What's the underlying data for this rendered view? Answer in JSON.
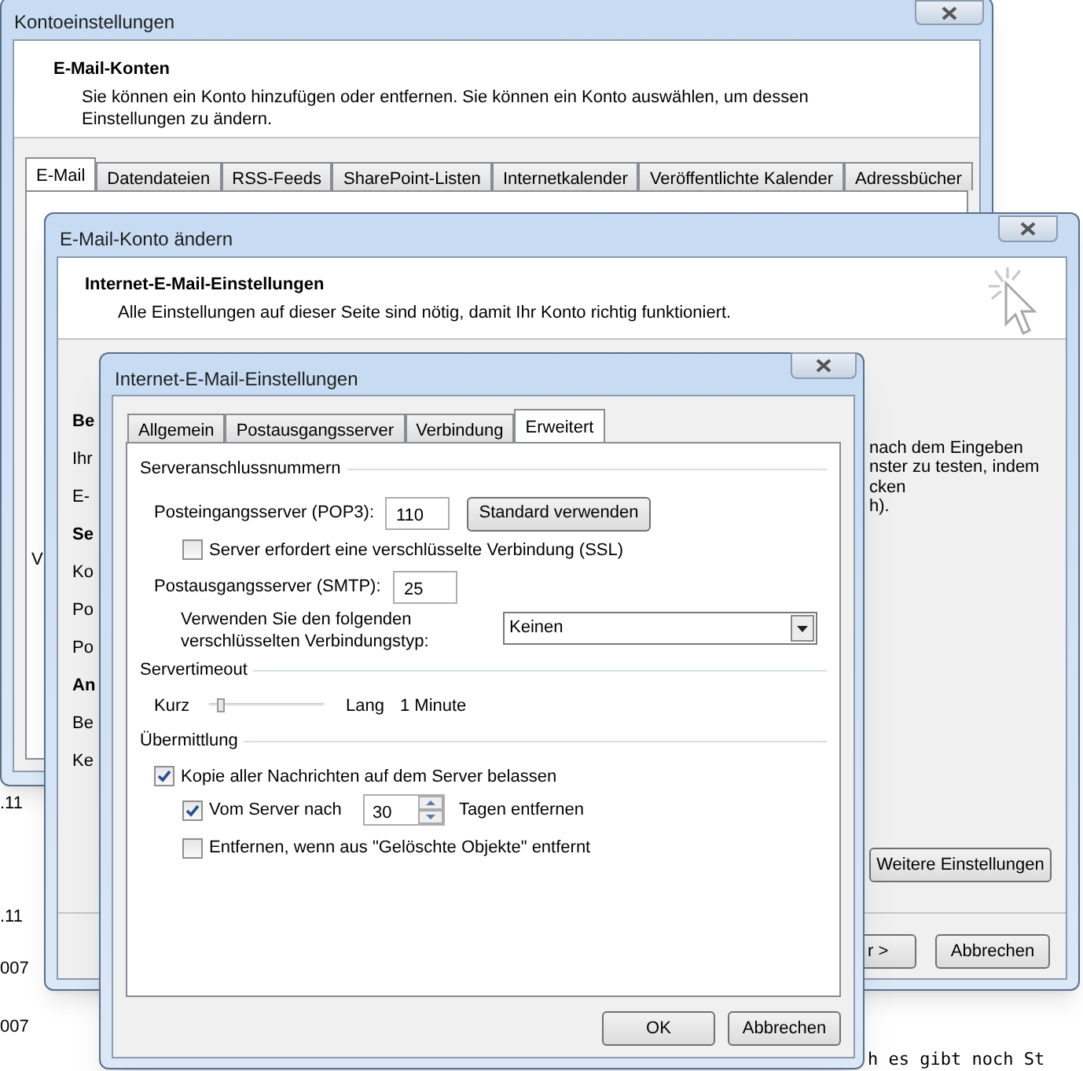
{
  "background_texts": [
    ".11",
    ".11",
    "007",
    "007",
    "h es gibt noch St"
  ],
  "account_settings": {
    "title": "Kontoeinstellungen",
    "header_title": "E-Mail-Konten",
    "header_text": "Sie können ein Konto hinzufügen oder entfernen. Sie können ein Konto auswählen, um dessen Einstellungen zu ändern.",
    "tabs": [
      {
        "label": "E-Mail",
        "selected": true
      },
      {
        "label": "Datendateien",
        "selected": false
      },
      {
        "label": "RSS-Feeds",
        "selected": false
      },
      {
        "label": "SharePoint-Listen",
        "selected": false
      },
      {
        "label": "Internetkalender",
        "selected": false
      },
      {
        "label": "Veröffentlichte Kalender",
        "selected": false
      },
      {
        "label": "Adressbücher",
        "selected": false
      }
    ],
    "partial_label": "V"
  },
  "change_account": {
    "title": "E-Mail-Konto ändern",
    "header_title": "Internet-E-Mail-Einstellungen",
    "header_text": "Alle Einstellungen auf dieser Seite sind nötig, damit Ihr Konto richtig funktioniert.",
    "left_labels": [
      {
        "text": "Be",
        "bold": true
      },
      {
        "text": "Ihr",
        "bold": false
      },
      {
        "text": "E-",
        "bold": false
      },
      {
        "text": "Se",
        "bold": true
      },
      {
        "text": "Ko",
        "bold": false
      },
      {
        "text": "Po",
        "bold": false
      },
      {
        "text": "Po",
        "bold": false
      },
      {
        "text": "An",
        "bold": true
      },
      {
        "text": "Be",
        "bold": false
      },
      {
        "text": "Ke",
        "bold": false
      }
    ],
    "right_text_lines": [
      "nach dem Eingeben",
      "nster zu testen, indem",
      "cken",
      "h)."
    ],
    "more_settings_button": "Weitere Einstellungen",
    "next_button": "r >",
    "cancel_button": "Abbrechen"
  },
  "internet_settings": {
    "title": "Internet-E-Mail-Einstellungen",
    "tabs": [
      {
        "label": "Allgemein",
        "selected": false
      },
      {
        "label": "Postausgangsserver",
        "selected": false
      },
      {
        "label": "Verbindung",
        "selected": false
      },
      {
        "label": "Erweitert",
        "selected": true
      }
    ],
    "ports_group": "Serveranschlussnummern",
    "incoming_label": "Posteingangsserver (POP3):",
    "incoming_value": "110",
    "default_button": "Standard verwenden",
    "ssl": {
      "label": "Server erfordert eine verschlüsselte Verbindung (SSL)",
      "checked": false
    },
    "outgoing_label": "Postausgangsserver (SMTP):",
    "outgoing_value": "25",
    "encryption_label": "Verwenden Sie den folgenden verschlüsselten Verbindungstyp:",
    "encryption_value": "Keinen",
    "timeout_group": "Servertimeout",
    "timeout_min": "Kurz",
    "timeout_max": "Lang",
    "timeout_slider": {
      "level": 0.1
    },
    "timeout_reading": "1 Minute",
    "delivery_group": "Übermittlung",
    "keep_copy": {
      "label": "Kopie aller Nachrichten auf dem Server belassen",
      "checked": true
    },
    "remove_after": {
      "label": "Vom Server nach",
      "checked": true,
      "days": "30",
      "suffix": "Tagen entfernen"
    },
    "remove_deleted": {
      "label": "Entfernen, wenn aus \"Gelöschte Objekte\" entfernt",
      "checked": false
    },
    "ok_button": "OK",
    "cancel_button": "Abbrechen"
  }
}
